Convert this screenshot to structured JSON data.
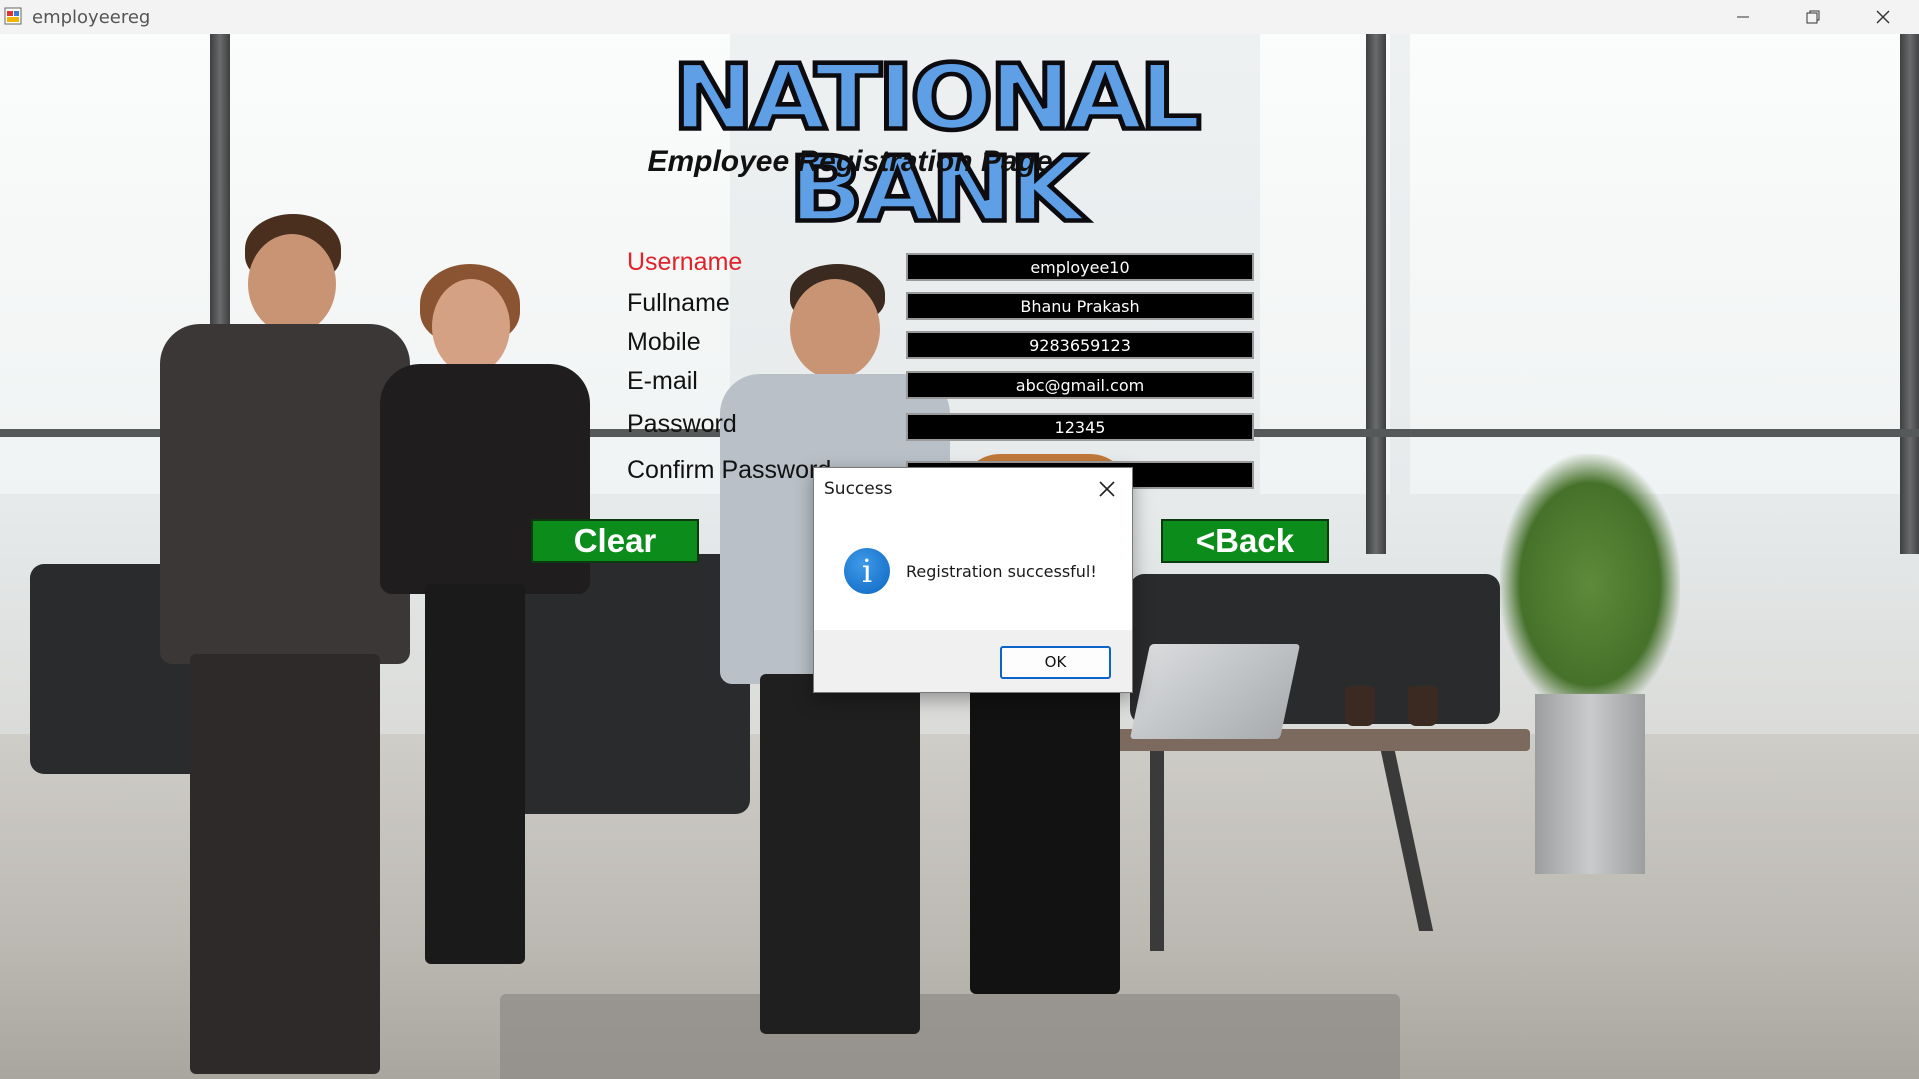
{
  "window": {
    "title": "employeereg",
    "icon": "app-icon",
    "controls": [
      "minimize-icon",
      "restore-icon",
      "close-icon"
    ]
  },
  "header": {
    "logo_text": "NATIONAL BANK",
    "subtitle": "Employee Registration Page"
  },
  "form": {
    "fields": [
      {
        "label": "Username",
        "value": "employee10"
      },
      {
        "label": "Fullname",
        "value": "Bhanu Prakash"
      },
      {
        "label": "Mobile",
        "value": "9283659123"
      },
      {
        "label": "E-mail",
        "value": "abc@gmail.com"
      },
      {
        "label": "Password",
        "value": "12345"
      },
      {
        "label": "Confirm Password",
        "value": ""
      }
    ],
    "clear_label": "Clear",
    "back_label": "<Back"
  },
  "dialog": {
    "title": "Success",
    "message": "Registration successful!",
    "ok_label": "OK",
    "icon": "info-icon"
  },
  "colors": {
    "active_label": "#e0232b",
    "button_green": "#0c8d1b",
    "logo_blue": "#5e9fe6",
    "input_bg": "#000000",
    "dialog_accent": "#0a64c9"
  }
}
